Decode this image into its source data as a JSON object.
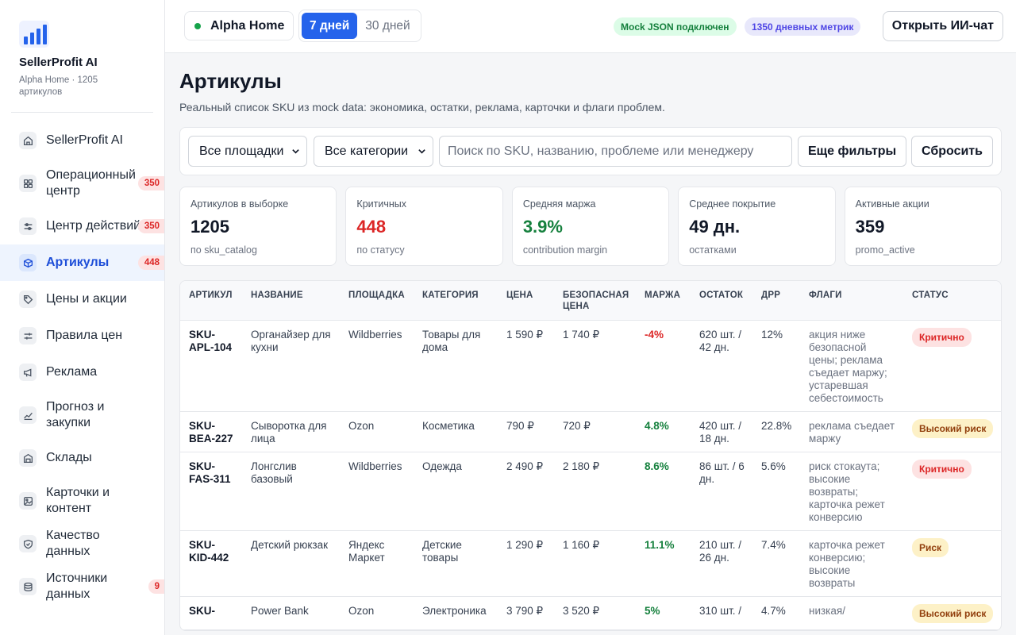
{
  "app": {
    "name": "SellerProfit AI",
    "subtitle": "Alpha Home · 1205 артикулов"
  },
  "sidebar": {
    "items": [
      {
        "label": "SellerProfit AI",
        "icon": "home-icon",
        "badge": ""
      },
      {
        "label": "Операционный центр",
        "icon": "grid-icon",
        "badge": "350"
      },
      {
        "label": "Центр действий",
        "icon": "sliders-icon",
        "badge": "350"
      },
      {
        "label": "Артикулы",
        "icon": "box-icon",
        "badge": "448",
        "active": true
      },
      {
        "label": "Цены и акции",
        "icon": "tag-icon",
        "badge": ""
      },
      {
        "label": "Правила цен",
        "icon": "rules-icon",
        "badge": ""
      },
      {
        "label": "Реклама",
        "icon": "megaphone-icon",
        "badge": ""
      },
      {
        "label": "Прогноз и закупки",
        "icon": "trend-icon",
        "badge": ""
      },
      {
        "label": "Склады",
        "icon": "warehouse-icon",
        "badge": ""
      },
      {
        "label": "Карточки и контент",
        "icon": "image-icon",
        "badge": ""
      },
      {
        "label": "Качество данных",
        "icon": "shield-icon",
        "badge": ""
      },
      {
        "label": "Источники данных",
        "icon": "database-icon",
        "badge": "9"
      }
    ]
  },
  "topbar": {
    "store": "Alpha Home",
    "periods": [
      "7 дней",
      "30 дней"
    ],
    "active_period": 0,
    "chip_mock": "Mock JSON подключен",
    "chip_metrics": "1350 дневных метрик",
    "ai_button": "Открыть ИИ-чат"
  },
  "page": {
    "title": "Артикулы",
    "subtitle": "Реальный список SKU из mock data: экономика, остатки, реклама, карточки и флаги проблем."
  },
  "filters": {
    "marketplace": "Все площадки",
    "category": "Все категории",
    "search_placeholder": "Поиск по SKU, названию, проблеме или менеджеру",
    "more": "Еще фильтры",
    "reset": "Сбросить"
  },
  "kpis": [
    {
      "label": "Артикулов в выборке",
      "value": "1205",
      "note": "по sku_catalog",
      "tone": "default"
    },
    {
      "label": "Критичных",
      "value": "448",
      "note": "по статусу",
      "tone": "red"
    },
    {
      "label": "Средняя маржа",
      "value": "3.9%",
      "note": "contribution margin",
      "tone": "green"
    },
    {
      "label": "Среднее покрытие",
      "value": "49 дн.",
      "note": "остатками",
      "tone": "default"
    },
    {
      "label": "Активные акции",
      "value": "359",
      "note": "promo_active",
      "tone": "default"
    }
  ],
  "table": {
    "headers": [
      "Артикул",
      "Название",
      "Площадка",
      "Категория",
      "Цена",
      "Безопасная цена",
      "Маржа",
      "Остаток",
      "ДРР",
      "Флаги",
      "Статус"
    ],
    "rows": [
      {
        "sku": "SKU-APL-104",
        "name": "Органайзер для кухни",
        "marketplace": "Wildberries",
        "category": "Товары для дома",
        "price": "1 590 ₽",
        "safe_price": "1 740 ₽",
        "margin": "-4%",
        "margin_tone": "neg",
        "stock": "620 шт. / 42 дн.",
        "drr": "12%",
        "flags": "акция ниже безопасной цены; реклама съедает маржу; устаревшая себестоимость",
        "status": "Критично",
        "status_tone": "crit"
      },
      {
        "sku": "SKU-BEA-227",
        "name": "Сыворотка для лица",
        "marketplace": "Ozon",
        "category": "Косметика",
        "price": "790 ₽",
        "safe_price": "720 ₽",
        "margin": "4.8%",
        "margin_tone": "pos",
        "stock": "420 шт. / 18 дн.",
        "drr": "22.8%",
        "flags": "реклама съедает маржу",
        "status": "Высокий риск",
        "status_tone": "high"
      },
      {
        "sku": "SKU-FAS-311",
        "name": "Лонгслив базовый",
        "marketplace": "Wildberries",
        "category": "Одежда",
        "price": "2 490 ₽",
        "safe_price": "2 180 ₽",
        "margin": "8.6%",
        "margin_tone": "pos",
        "stock": "86 шт. / 6 дн.",
        "drr": "5.6%",
        "flags": "риск стокаута; высокие возвраты; карточка режет конверсию",
        "status": "Критично",
        "status_tone": "crit"
      },
      {
        "sku": "SKU-KID-442",
        "name": "Детский рюкзак",
        "marketplace": "Яндекс Маркет",
        "category": "Детские товары",
        "price": "1 290 ₽",
        "safe_price": "1 160 ₽",
        "margin": "11.1%",
        "margin_tone": "pos",
        "stock": "210 шт. / 26 дн.",
        "drr": "7.4%",
        "flags": "карточка режет конверсию; высокие возвраты",
        "status": "Риск",
        "status_tone": "risk"
      },
      {
        "sku": "SKU-",
        "name": "Power Bank",
        "marketplace": "Ozon",
        "category": "Электроника",
        "price": "3 790 ₽",
        "safe_price": "3 520 ₽",
        "margin": "5%",
        "margin_tone": "pos",
        "stock": "310 шт. /",
        "drr": "4.7%",
        "flags": "низкая/",
        "status": "Высокий риск",
        "status_tone": "high"
      }
    ]
  },
  "colors": {
    "accent": "#2563eb",
    "critical": "#dc2626",
    "positive": "#15803d"
  }
}
